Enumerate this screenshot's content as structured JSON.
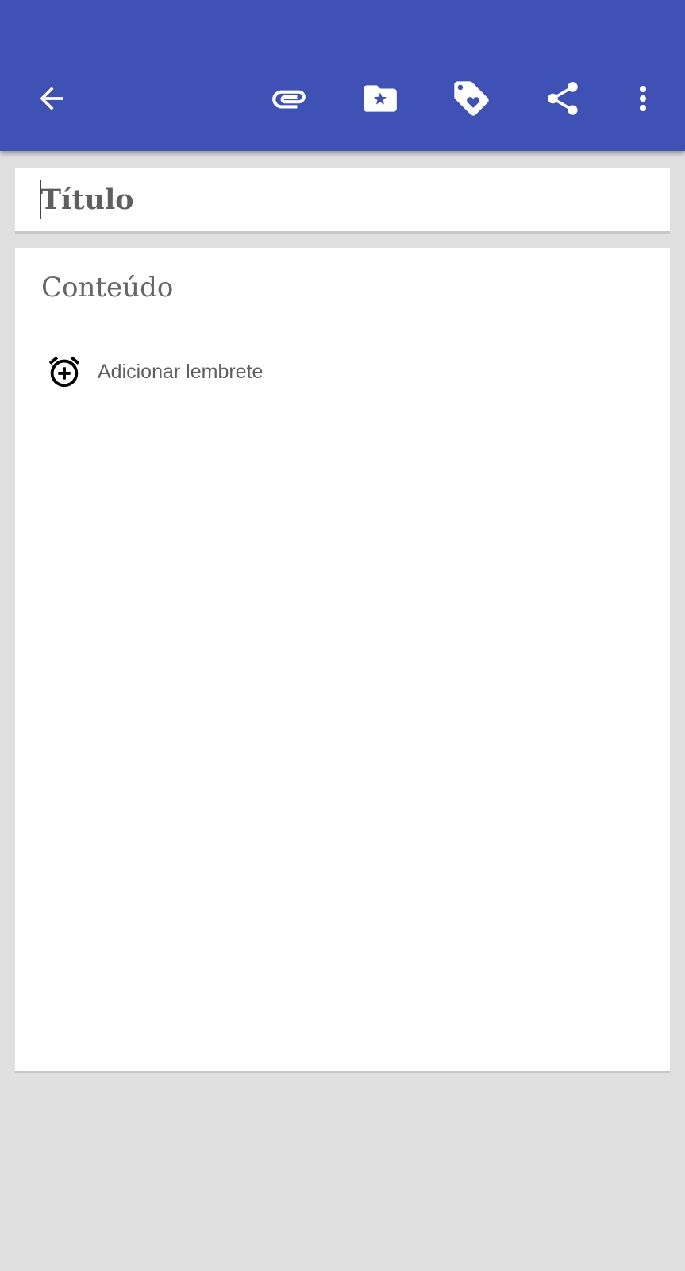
{
  "toolbar": {
    "background": "#3f51b5",
    "icon_color": "#ffffff",
    "actions": [
      {
        "name": "back",
        "icon": "arrow-back-icon"
      },
      {
        "name": "attach",
        "icon": "paperclip-icon"
      },
      {
        "name": "category",
        "icon": "folder-star-icon"
      },
      {
        "name": "tag",
        "icon": "tag-heart-icon"
      },
      {
        "name": "share",
        "icon": "share-icon"
      },
      {
        "name": "more",
        "icon": "more-vert-icon"
      }
    ]
  },
  "note": {
    "title_placeholder": "Título",
    "title_value": "",
    "content_placeholder": "Conteúdo",
    "content_value": ""
  },
  "reminder": {
    "icon": "alarm-add-icon",
    "label": "Adicionar lembrete"
  }
}
